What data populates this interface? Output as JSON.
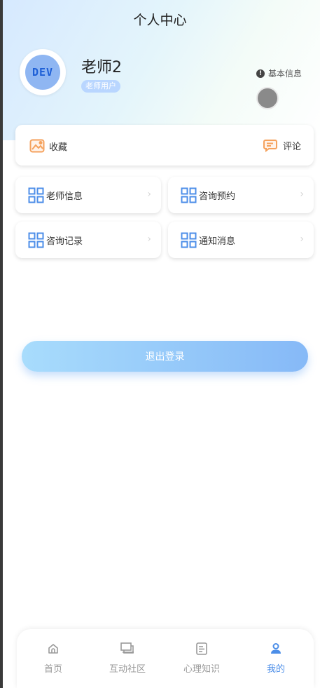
{
  "header": {
    "title": "个人中心"
  },
  "profile": {
    "avatar_text": "DEV",
    "name": "老师2",
    "role": "老师用户",
    "basic_info_label": "基本信息"
  },
  "favorites_card": {
    "favorite_label": "收藏",
    "comment_label": "评论"
  },
  "menu": [
    {
      "label": "老师信息"
    },
    {
      "label": "咨询预约"
    },
    {
      "label": "咨询记录"
    },
    {
      "label": "通知消息"
    }
  ],
  "logout_label": "退出登录",
  "tabbar": {
    "items": [
      {
        "label": "首页",
        "icon": "home-icon",
        "active": false
      },
      {
        "label": "互动社区",
        "icon": "chat-icon",
        "active": false
      },
      {
        "label": "心理知识",
        "icon": "document-icon",
        "active": false
      },
      {
        "label": "我的",
        "icon": "user-icon",
        "active": true
      }
    ]
  },
  "colors": {
    "accent": "#4c8ee8",
    "icon_blue": "#4c8ee8",
    "favorite_orange": "#f5a25d",
    "logout_gradient_start": "#a8dcfc",
    "logout_gradient_end": "#86b9f7"
  }
}
